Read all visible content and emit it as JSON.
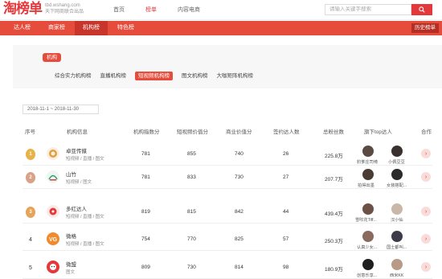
{
  "header": {
    "logo": "淘榜单",
    "domain": "tbd.wshang.com",
    "slogan": "天下网商联合出品",
    "nav": [
      "首页",
      "榜单",
      "内容电商"
    ],
    "nav_active": 1,
    "search_placeholder": "请输入关键字搜索"
  },
  "rednav": {
    "items": [
      "达人榜",
      "商家榜",
      "机构榜",
      "特色榜"
    ],
    "selected": 2,
    "history": "历史榜单"
  },
  "panel": {
    "tag": "机构",
    "subtabs": [
      "综合实力机构榜",
      "直播机构榜",
      "短视频机构榜",
      "图文机构榜",
      "大咖矩阵机构榜"
    ],
    "selected": 2
  },
  "date_range": "2018-11-1 ~ 2018-11-30",
  "table": {
    "headers": [
      "序号",
      "机构信息",
      "机构指数分",
      "短视频价值分",
      "商业价值分",
      "签约达人数",
      "总粉丝数",
      "旗下top达人",
      "合作"
    ],
    "rows": [
      {
        "rank": "1",
        "name": "卓亚传媒",
        "sub": "短视频 / 直播 / 图文",
        "index": "781",
        "video": "855",
        "biz": "740",
        "signed": "26",
        "fans": "225.8万",
        "talents": [
          "豹爹庄司绮",
          "小佩豆豆"
        ]
      },
      {
        "rank": "2",
        "name": "山竹",
        "sub": "短视频 / 图文",
        "index": "781",
        "video": "833",
        "biz": "730",
        "signed": "27",
        "fans": "207.7万",
        "talents": [
          "拍得出墨",
          "女装搭配..."
        ]
      },
      {
        "rank": "3",
        "name": "多红达人",
        "sub": "短视频 / 直播 / 图文",
        "index": "819",
        "video": "815",
        "biz": "842",
        "signed": "44",
        "fans": "439.4万",
        "talents": [
          "雪吹花Tiff...",
          "汉小仙"
        ]
      },
      {
        "rank": "4",
        "name": "微格",
        "sub": "短视频 / 直播 / 图文",
        "index": "754",
        "video": "770",
        "biz": "825",
        "signed": "57",
        "fans": "250.3万",
        "talents": [
          "认真少女...",
          "国土都叫..."
        ]
      },
      {
        "rank": "5",
        "name": "微盟",
        "sub": "图文",
        "index": "809",
        "video": "730",
        "biz": "814",
        "signed": "98",
        "fans": "180.9万",
        "talents": [
          "创意乐享...",
          "西米KK"
        ]
      }
    ]
  },
  "colors": {
    "accent": "#e4393c",
    "nav": "#e64c3c",
    "gold": "#e8b24a",
    "silver": "#d9a188",
    "bronze": "#e6a35a"
  }
}
